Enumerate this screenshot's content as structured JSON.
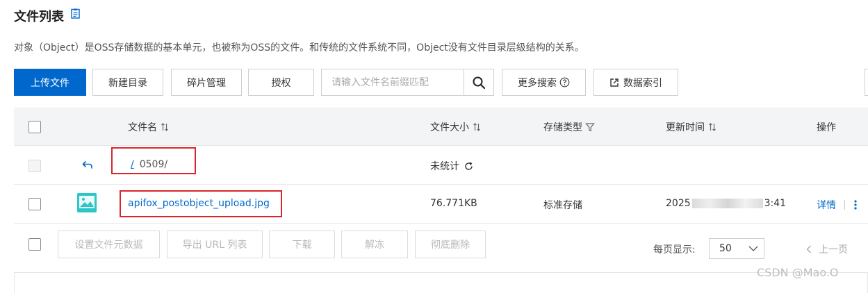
{
  "header": {
    "title": "文件列表",
    "title_icon": "document-icon",
    "description": "对象（Object）是OSS存储数据的基本单元，也被称为OSS的文件。和传统的文件系统不同，Object没有文件目录层级结构的关系。"
  },
  "toolbar": {
    "upload": "上传文件",
    "new_dir": "新建目录",
    "fragments": "碎片管理",
    "authorize": "授权",
    "search_placeholder": "请输入文件名前缀匹配",
    "more_search": "更多搜索",
    "data_index": "数据索引"
  },
  "table": {
    "headers": {
      "name": "文件名",
      "size": "文件大小",
      "storage": "存储类型",
      "updated": "更新时间",
      "actions": "操作"
    },
    "rows": [
      {
        "path_root": "/",
        "path": "0509/",
        "size": "未统计"
      },
      {
        "name": "apifox_postobject_upload.jpg",
        "size": "76.771KB",
        "storage": "标准存储",
        "time_start": "2025",
        "time_end": "3:41",
        "detail": "详情"
      }
    ]
  },
  "footer": {
    "set_meta": "设置文件元数据",
    "export_url": "导出 URL 列表",
    "download": "下载",
    "unfreeze": "解冻",
    "delete": "彻底删除",
    "per_page_label": "每页显示:",
    "per_page_value": "50",
    "prev_page": "上一页"
  },
  "watermark": "CSDN @Mao.O",
  "colors": {
    "primary": "#0068cd",
    "highlight": "#d9252a"
  }
}
